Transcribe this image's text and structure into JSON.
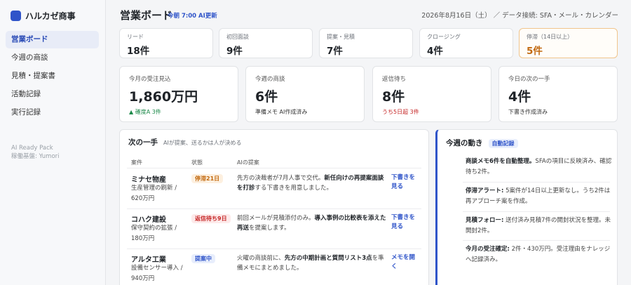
{
  "app": {
    "name": "ハルカゼ商事",
    "brand_color": "#2f54c9"
  },
  "sidebar": {
    "items": [
      {
        "label": "営業ボード",
        "active": true
      },
      {
        "label": "今週の商談"
      },
      {
        "label": "見積・提案書"
      },
      {
        "label": "活動記録"
      },
      {
        "label": "実行記録"
      }
    ],
    "footer_line1": "AI Ready Pack",
    "footer_line2": "稼働基盤: Yumori"
  },
  "header": {
    "title": "営業ボード",
    "update_badge": "今朝 7:00 AI更新",
    "date_info": "2026年8月16日（土） ／ データ接続: SFA・メール・カレンダー"
  },
  "stages": [
    {
      "label": "リード",
      "value": "18件"
    },
    {
      "label": "初回面談",
      "value": "9件"
    },
    {
      "label": "提案・見積",
      "value": "7件"
    },
    {
      "label": "クロージング",
      "value": "4件"
    },
    {
      "label": "停滞（14日以上）",
      "value": "5件",
      "warn_color": "#c2690f"
    }
  ],
  "kpis": [
    {
      "label": "今月の受注見込",
      "value": "1,860万円",
      "sub": "▲ 確度A 3件"
    },
    {
      "label": "今週の商談",
      "value": "6件",
      "sub": "準備メモ AI作成済み"
    },
    {
      "label": "返信待ち",
      "value": "8件",
      "sub": "うち5日超 3件"
    },
    {
      "label": "今日の次の一手",
      "value": "4件",
      "sub": "下書き作成済み"
    }
  ],
  "next_actions": {
    "title": "次の一手",
    "subtitle": "AIが提案、送るかは人が決める",
    "columns": [
      "案件",
      "状態",
      "AIの提案"
    ],
    "rows": [
      {
        "company": "ミナセ物産",
        "detail": "生産管理の刷新 / 620万円",
        "status": "停滞21日",
        "ai_pre": "先方の決裁者が7月人事で交代。",
        "ai_bold": "新任向けの再提案面談を打診",
        "ai_post": "する下書きを用意しました。",
        "action": "下書きを見る"
      },
      {
        "company": "コハク建設",
        "detail": "保守契約の拡張 / 180万円",
        "status": "返信待ち9日",
        "ai_pre": "前回メールが見積添付のみ。",
        "ai_bold": "導入事例の比較表を添えた再送",
        "ai_post": "を提案します。",
        "action": "下書きを見る"
      },
      {
        "company": "アルタ工業",
        "detail": "設備センサー導入 / 940万円",
        "status": "提案中",
        "ai_pre": "火曜の商談前に、",
        "ai_bold": "先方の中期計画と質問リスト3点",
        "ai_post": "を準備メモにまとめました。",
        "action": "メモを開く"
      }
    ]
  },
  "weekly": {
    "title": "今週の動き",
    "badge": "自動記録",
    "items": [
      {
        "bold": "商談メモ6件を自動整理。",
        "text": "SFAの項目に反映済み、確認待ち2件。"
      },
      {
        "bold": "停滞アラート:",
        "text": " 5案件が14日以上更新なし。うち2件は再アプローチ案を作成。"
      },
      {
        "bold": "見積フォロー:",
        "text": " 送付済み見積7件の開封状況を整理。未開封2件。"
      },
      {
        "bold": "今月の受注確定:",
        "text": " 2件・430万円。受注理由をナレッジへ記録済み。"
      }
    ]
  }
}
